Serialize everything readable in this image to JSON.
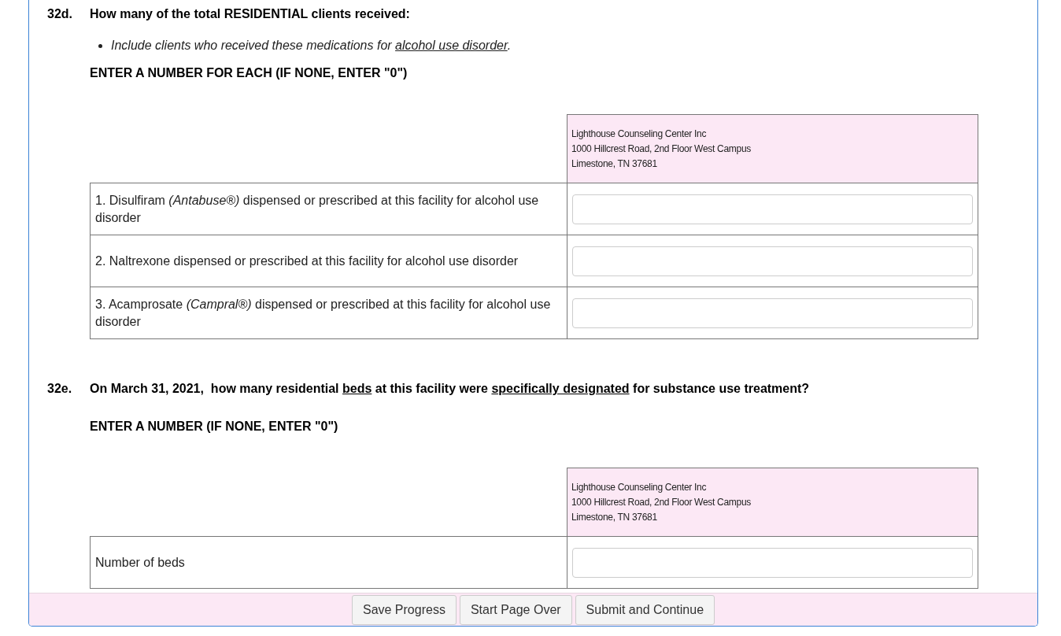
{
  "questions": [
    {
      "number": "32d.",
      "text": [
        {
          "text": "How many of the total RESIDENTIAL clients received:",
          "underline": false
        }
      ],
      "bullets": [
        [
          {
            "text": "Include clients who received these medications for ",
            "underline": false
          },
          {
            "text": "alcohol use disorder",
            "underline": true
          },
          {
            "text": ".",
            "underline": false
          }
        ]
      ],
      "instruction": "ENTER A NUMBER FOR EACH (IF NONE, ENTER \"0\")",
      "facility": [
        "Lighthouse Counseling Center Inc",
        "1000 Hillcrest Road, 2nd Floor West Campus",
        "Limestone, TN 37681"
      ],
      "rows": [
        {
          "label": "1. Disulfiram *(Antabuse®)* dispensed or prescribed at this facility for alcohol use disorder"
        },
        {
          "label": "2. Naltrexone dispensed or prescribed at this facility for alcohol use disorder"
        },
        {
          "label": "3. Acamprosate *(Campral®)* dispensed or prescribed at this facility for alcohol use disorder"
        }
      ]
    },
    {
      "number": "32e.",
      "text": [
        {
          "text": "On March 31, 2021,  how many residential ",
          "underline": false
        },
        {
          "text": "beds",
          "underline": true
        },
        {
          "text": " at this facility were ",
          "underline": false
        },
        {
          "text": "specifically designated",
          "underline": true
        },
        {
          "text": " for substance use treatment?",
          "underline": false
        }
      ],
      "instruction": "ENTER A NUMBER (IF NONE, ENTER \"0\")",
      "facility": [
        "Lighthouse Counseling Center Inc",
        "1000 Hillcrest Road, 2nd Floor West Campus",
        "Limestone, TN 37681"
      ],
      "rows": [
        {
          "label": "Number of beds"
        }
      ]
    }
  ],
  "buttons": [
    "Save Progress",
    "Start Page Over",
    "Submit and Continue"
  ]
}
